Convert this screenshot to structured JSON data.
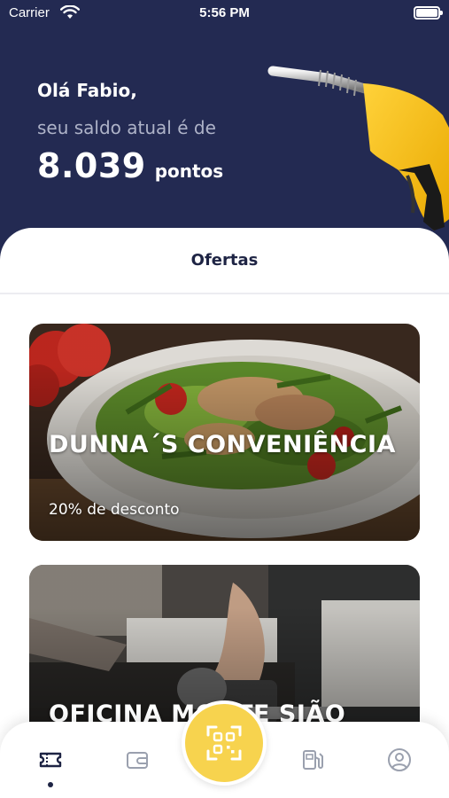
{
  "status_bar": {
    "carrier": "Carrier",
    "time": "5:56 PM"
  },
  "header": {
    "greeting": "Olá Fabio,",
    "subtitle": "seu saldo atual é de",
    "points_value": "8.039",
    "points_unit": "pontos"
  },
  "offers": {
    "title": "Ofertas",
    "items": [
      {
        "name": "DUNNA´S CONVENIÊNCIA",
        "discount": "20% de desconto",
        "image": "salad-plate-photo"
      },
      {
        "name": "OFICINA MONTE SIÃO",
        "image": "mechanic-engine-photo"
      }
    ]
  },
  "tab_bar": {
    "items": [
      {
        "icon": "ticket-icon",
        "active": true
      },
      {
        "icon": "wallet-icon",
        "active": false
      },
      {
        "icon": "qr-code-icon",
        "active": false
      },
      {
        "icon": "fuel-pump-icon",
        "active": false
      },
      {
        "icon": "user-icon",
        "active": false
      }
    ]
  },
  "colors": {
    "header_bg": "#232a52",
    "accent_yellow": "#f7d34e",
    "text_dark": "#1e2444",
    "subtitle_text": "#aeb3c8"
  }
}
